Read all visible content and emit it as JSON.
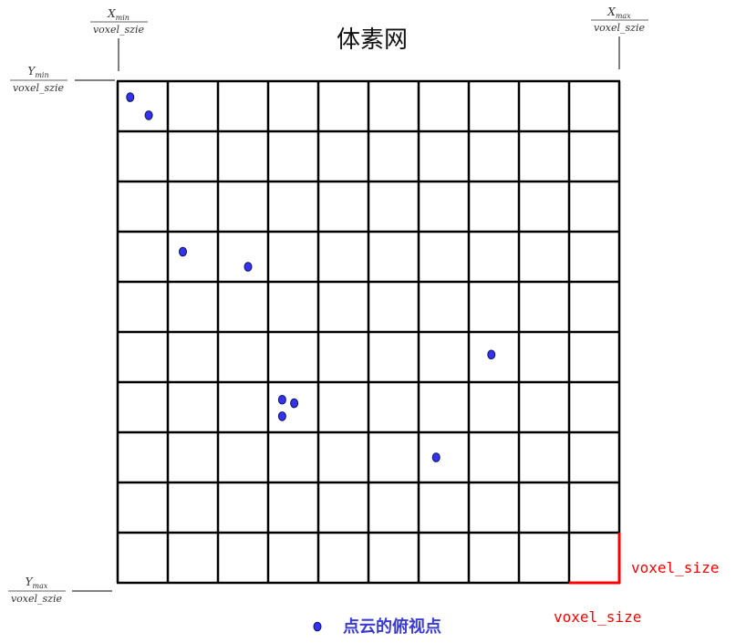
{
  "title": "体素网",
  "labels": {
    "x_min": {
      "numerator": "X",
      "numerator_sub": "min",
      "denominator": "voxel_szie"
    },
    "x_max": {
      "numerator": "X",
      "numerator_sub": "max",
      "denominator": "voxel_szie"
    },
    "y_min": {
      "numerator": "Y",
      "numerator_sub": "min",
      "denominator": "voxel_szie"
    },
    "y_max": {
      "numerator": "Y",
      "numerator_sub": "max",
      "denominator": "voxel_szie"
    }
  },
  "voxel_size_label_vertical": "voxel_size",
  "voxel_size_label_horizontal": "voxel_size",
  "legend": {
    "label": "点云的俯视点",
    "marker_icon": "point-marker-icon"
  },
  "grid": {
    "rows": 10,
    "cols": 10
  },
  "points": [
    {
      "col": 0.25,
      "row": 0.32
    },
    {
      "col": 0.62,
      "row": 0.68
    },
    {
      "col": 1.3,
      "row": 3.4
    },
    {
      "col": 2.6,
      "row": 3.7
    },
    {
      "col": 7.45,
      "row": 5.45
    },
    {
      "col": 3.28,
      "row": 6.35
    },
    {
      "col": 3.52,
      "row": 6.42
    },
    {
      "col": 3.28,
      "row": 6.68
    },
    {
      "col": 6.35,
      "row": 7.5
    }
  ],
  "colors": {
    "grid_line": "#000000",
    "point_fill": "#3333ee",
    "point_stroke": "#111166",
    "voxel_highlight": "#ff0000",
    "legend_text": "#3b3bd6"
  }
}
